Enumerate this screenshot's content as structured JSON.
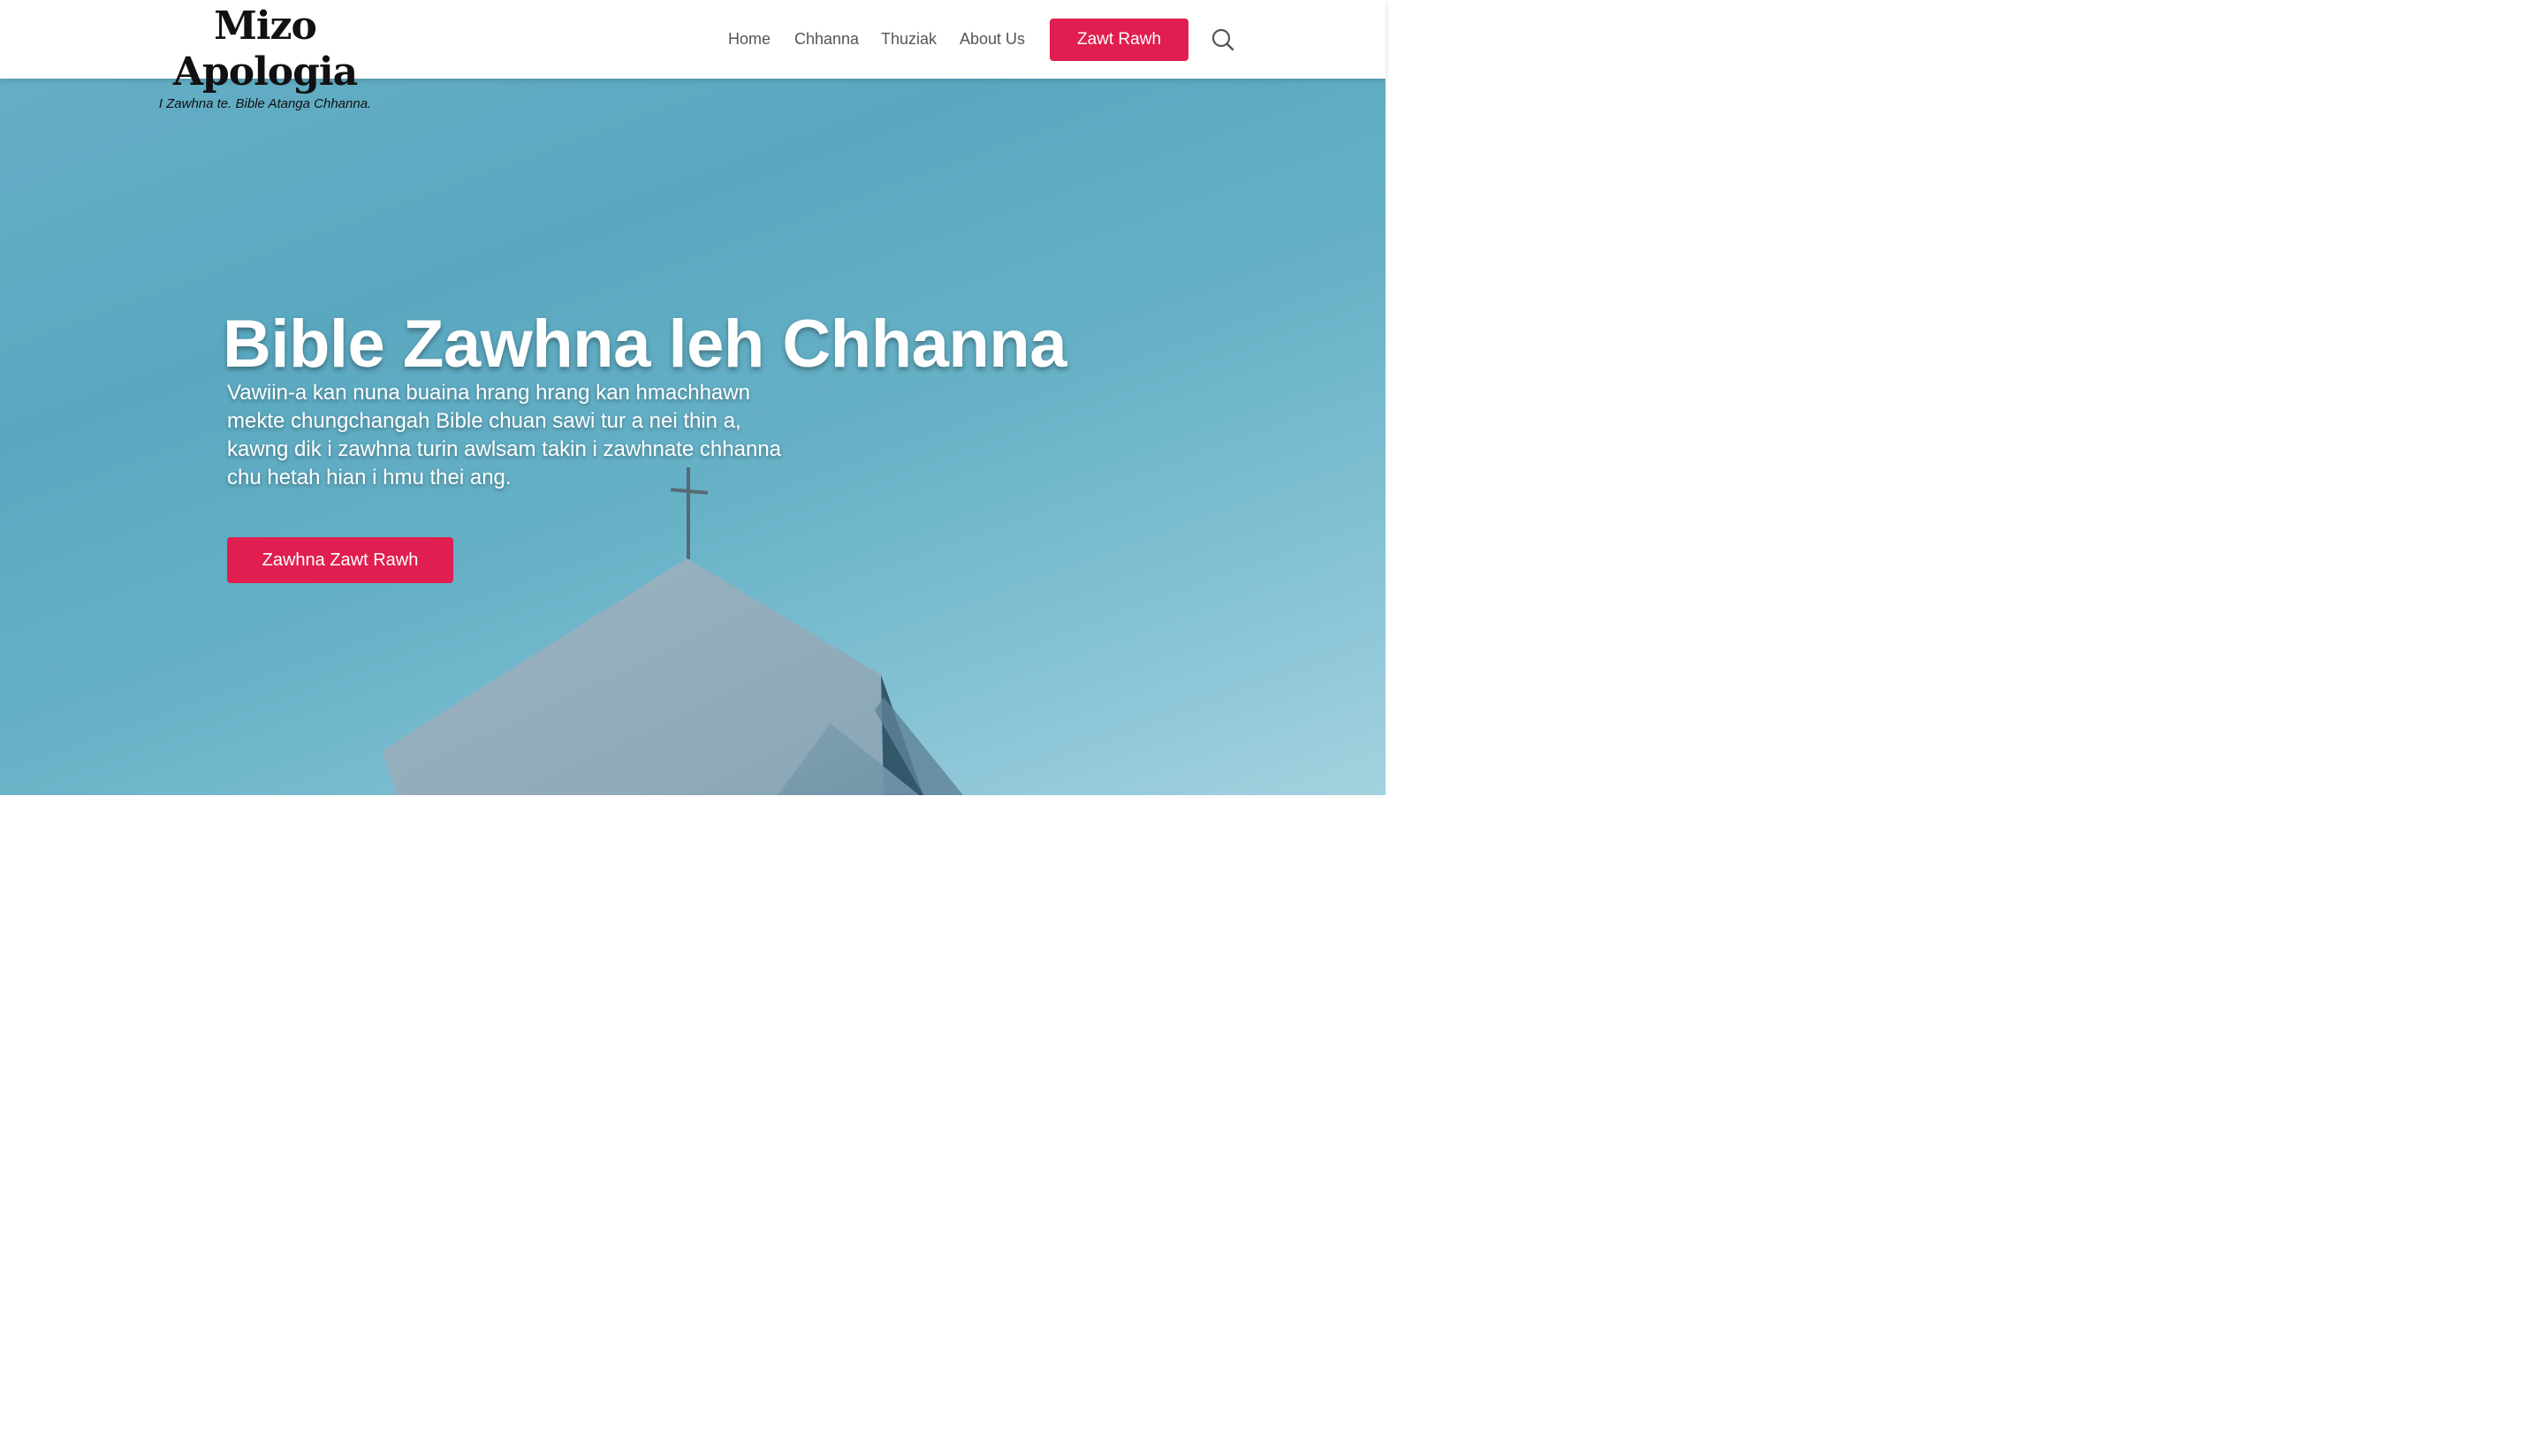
{
  "site": {
    "title": "Mizo Apologia",
    "tagline": "I Zawhna te. Bible Atanga Chhanna."
  },
  "nav": {
    "items": [
      {
        "label": "Home"
      },
      {
        "label": "Chhanna"
      },
      {
        "label": "Thuziak"
      },
      {
        "label": "About Us"
      }
    ],
    "cta_label": "Zawt Rawh",
    "search_icon": "search-icon"
  },
  "hero": {
    "title": "Bible Zawhna leh Chhanna",
    "subtitle": "Vawiin-a kan nuna buaina hrang hrang kan hmachhawn mekte chungchangah Bible chuan sawi tur a nei thin a, kawng dik i zawhna turin awlsam takin i zawhnate chhanna chu hetah hian i hmu thei ang.",
    "cta_label": "Zawhna Zawt Rawh"
  },
  "colors": {
    "accent": "#e01e4f",
    "sky": "#5aa8c0",
    "nav_text": "#555555"
  }
}
